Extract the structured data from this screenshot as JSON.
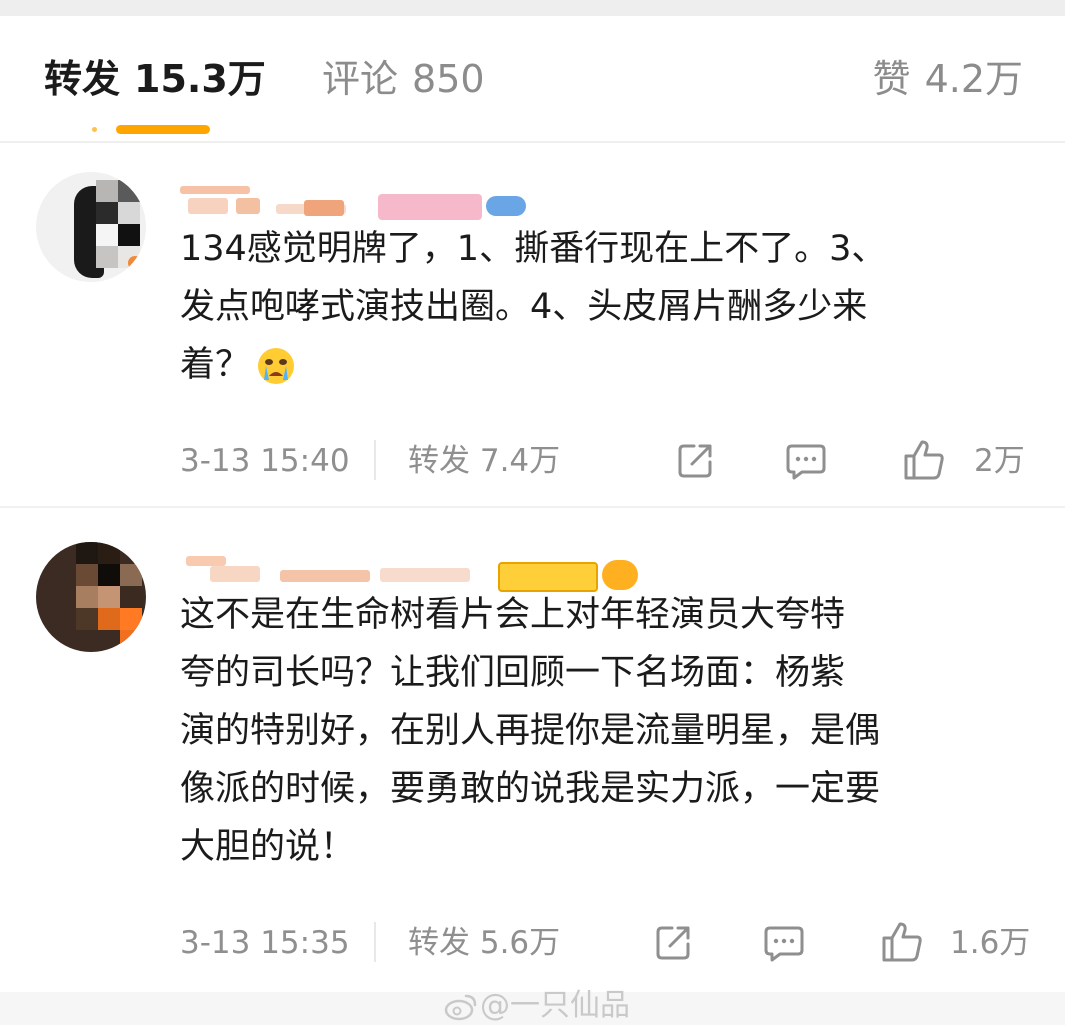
{
  "tabs": {
    "repost": {
      "label": "转发",
      "count": "15.3万"
    },
    "comment": {
      "label": "评论",
      "count": "850"
    },
    "like": {
      "label": "赞",
      "count": "4.2万"
    }
  },
  "comments": [
    {
      "text": "134感觉明牌了，1、撕番行现在上不了。3、\n发点咆哮式演技出圈。4、头皮屑片酬多少来\n着？",
      "emoji": "cry-emoji",
      "time": "3-13 15:40",
      "repost_label": "转发 7.4万",
      "like_count": "2万"
    },
    {
      "text": "这不是在生命树看片会上对年轻演员大夸特\n夸的司长吗？让我们回顾一下名场面：杨紫\n演的特别好，在别人再提你是流量明星，是偶\n像派的时候，要勇敢的说我是实力派，一定要\n大胆的说！",
      "time": "3-13 15:35",
      "repost_label": "转发 5.6万",
      "like_count": "1.6万"
    }
  ],
  "watermark": "@一只仙品",
  "colors": {
    "accent": "#ffa500",
    "muted": "#8f8f8f"
  }
}
